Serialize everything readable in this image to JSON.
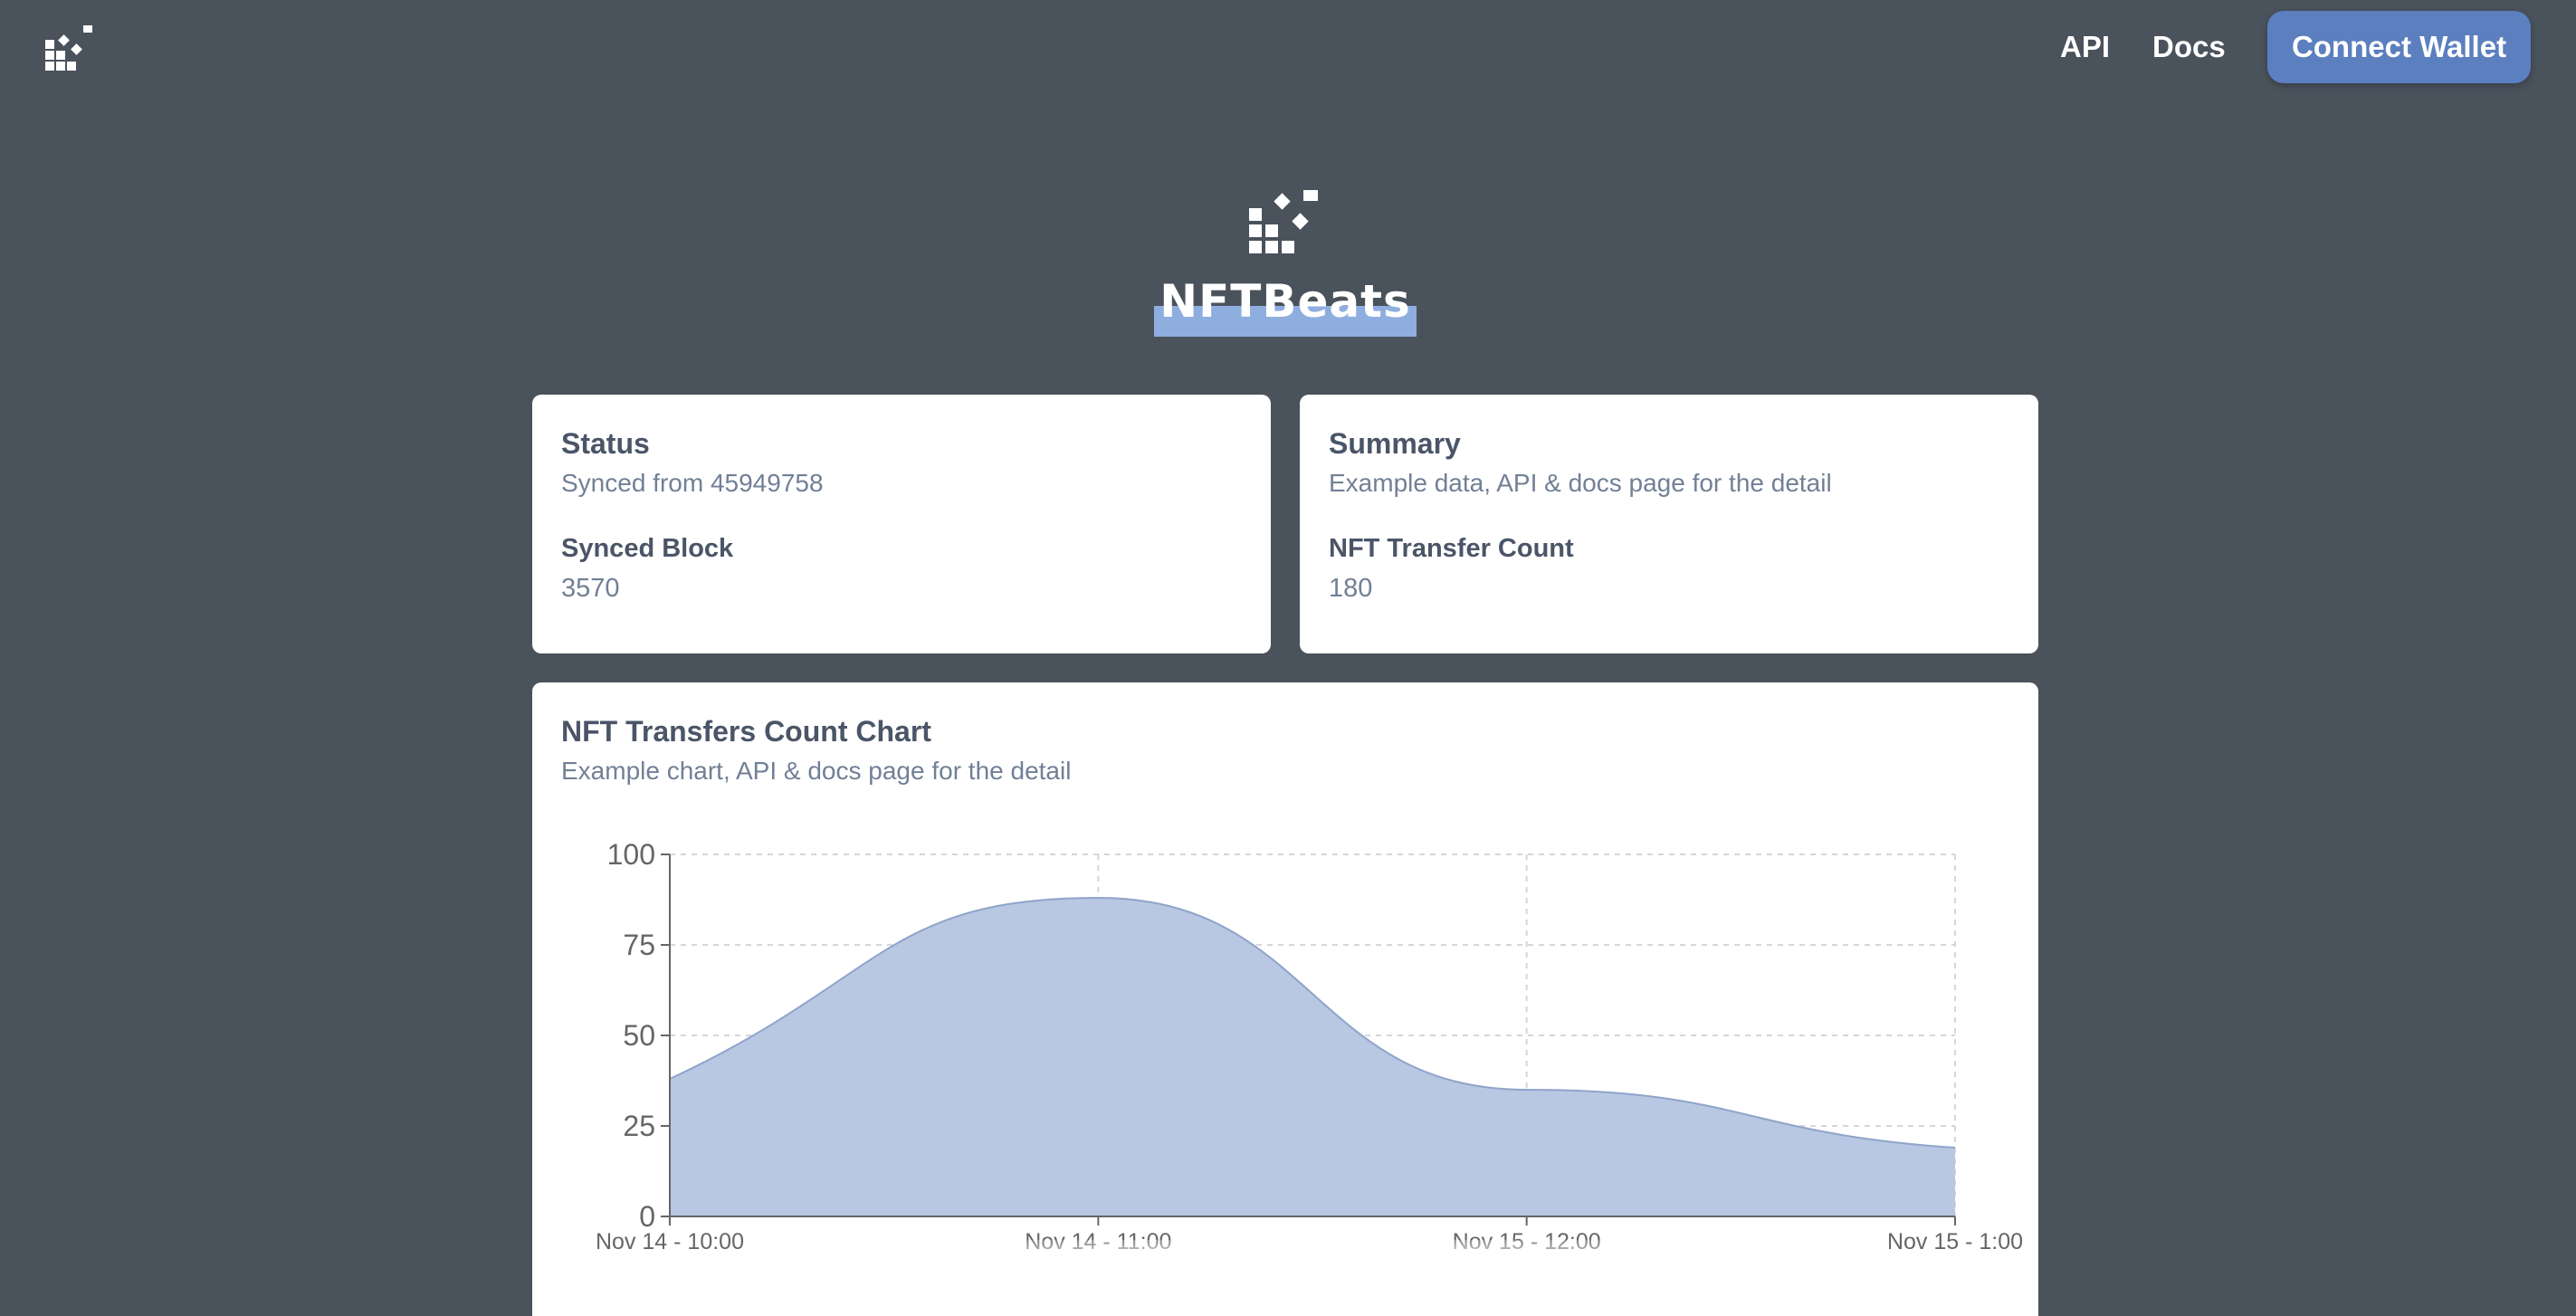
{
  "header": {
    "logo_icon": "nftbeats-logo-icon",
    "nav": [
      {
        "label": "API"
      },
      {
        "label": "Docs"
      }
    ],
    "connect_wallet_label": "Connect Wallet",
    "accent_color": "#5b7fbf"
  },
  "hero": {
    "logo_icon": "nftbeats-logo-icon",
    "brand_name": "NFTBeats",
    "highlight_color": "#8faee0"
  },
  "status_card": {
    "title": "Status",
    "subtitle": "Synced from 45949758",
    "stat_label": "Synced Block",
    "stat_value": "3570"
  },
  "summary_card": {
    "title": "Summary",
    "subtitle": "Example data, API & docs page for the detail",
    "stat_label": "NFT Transfer Count",
    "stat_value": "180"
  },
  "chart_card": {
    "title": "NFT Transfers Count Chart",
    "subtitle": "Example chart, API & docs page for the detail"
  },
  "chart_data": {
    "type": "area",
    "x": [
      "Nov 14 - 10:00",
      "Nov 14 - 11:00",
      "Nov 15 - 12:00",
      "Nov 15 - 1:00"
    ],
    "series": [
      {
        "values": [
          38,
          88,
          35,
          19
        ],
        "color": "#b8c7e2",
        "stroke": "#8fa4c9"
      }
    ],
    "ylim": [
      0,
      100
    ],
    "yticks": [
      0,
      25,
      50,
      75,
      100
    ],
    "grid": true,
    "xlabel": "",
    "ylabel": ""
  }
}
